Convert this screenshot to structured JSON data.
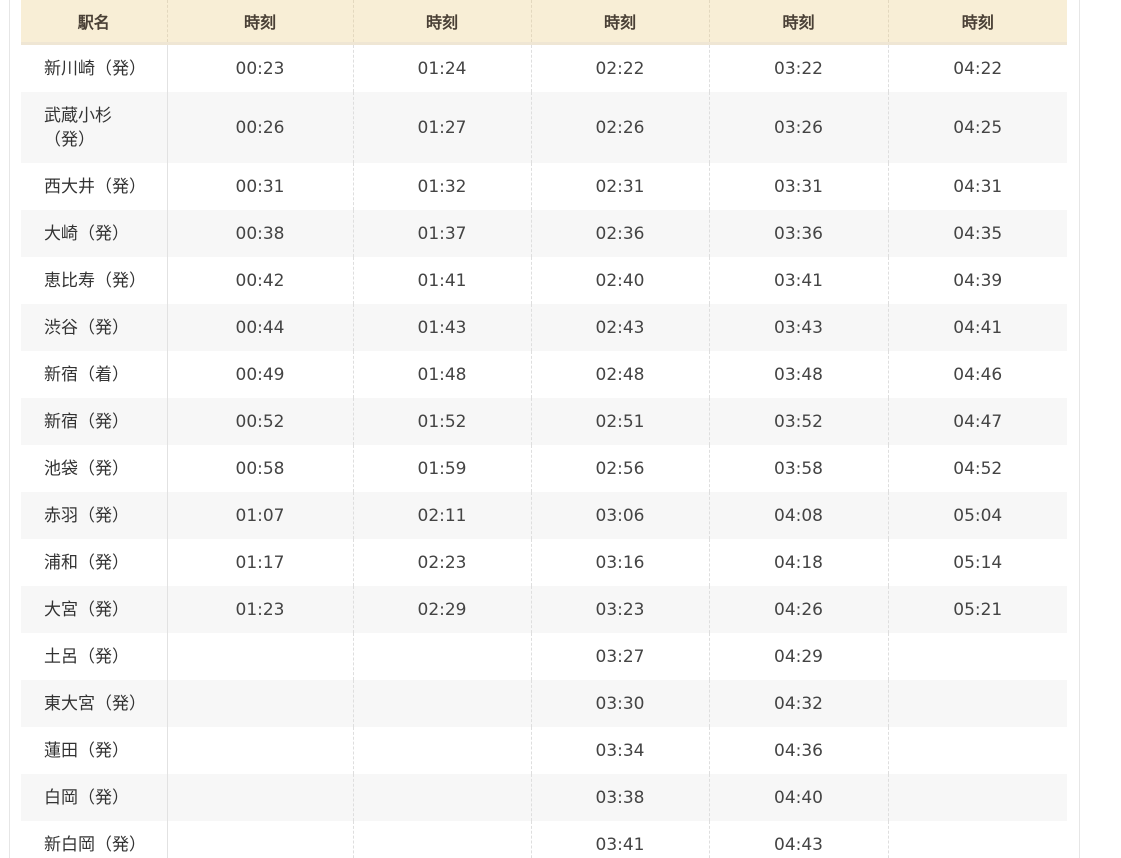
{
  "table": {
    "headers": [
      "駅名",
      "時刻",
      "時刻",
      "時刻",
      "時刻",
      "時刻"
    ],
    "rows": [
      {
        "station": "新川崎（発）",
        "times": [
          "00:23",
          "01:24",
          "02:22",
          "03:22",
          "04:22"
        ]
      },
      {
        "station": "武蔵小杉（発）",
        "times": [
          "00:26",
          "01:27",
          "02:26",
          "03:26",
          "04:25"
        ]
      },
      {
        "station": "西大井（発）",
        "times": [
          "00:31",
          "01:32",
          "02:31",
          "03:31",
          "04:31"
        ]
      },
      {
        "station": "大崎（発）",
        "times": [
          "00:38",
          "01:37",
          "02:36",
          "03:36",
          "04:35"
        ]
      },
      {
        "station": "恵比寿（発）",
        "times": [
          "00:42",
          "01:41",
          "02:40",
          "03:41",
          "04:39"
        ]
      },
      {
        "station": "渋谷（発）",
        "times": [
          "00:44",
          "01:43",
          "02:43",
          "03:43",
          "04:41"
        ]
      },
      {
        "station": "新宿（着）",
        "times": [
          "00:49",
          "01:48",
          "02:48",
          "03:48",
          "04:46"
        ]
      },
      {
        "station": "新宿（発）",
        "times": [
          "00:52",
          "01:52",
          "02:51",
          "03:52",
          "04:47"
        ]
      },
      {
        "station": "池袋（発）",
        "times": [
          "00:58",
          "01:59",
          "02:56",
          "03:58",
          "04:52"
        ]
      },
      {
        "station": "赤羽（発）",
        "times": [
          "01:07",
          "02:11",
          "03:06",
          "04:08",
          "05:04"
        ]
      },
      {
        "station": "浦和（発）",
        "times": [
          "01:17",
          "02:23",
          "03:16",
          "04:18",
          "05:14"
        ]
      },
      {
        "station": "大宮（発）",
        "times": [
          "01:23",
          "02:29",
          "03:23",
          "04:26",
          "05:21"
        ]
      },
      {
        "station": "土呂（発）",
        "times": [
          "",
          "",
          "03:27",
          "04:29",
          ""
        ]
      },
      {
        "station": "東大宮（発）",
        "times": [
          "",
          "",
          "03:30",
          "04:32",
          ""
        ]
      },
      {
        "station": "蓮田（発）",
        "times": [
          "",
          "",
          "03:34",
          "04:36",
          ""
        ]
      },
      {
        "station": "白岡（発）",
        "times": [
          "",
          "",
          "03:38",
          "04:40",
          ""
        ]
      },
      {
        "station": "新白岡（発）",
        "times": [
          "",
          "",
          "03:41",
          "04:43",
          ""
        ]
      }
    ]
  }
}
